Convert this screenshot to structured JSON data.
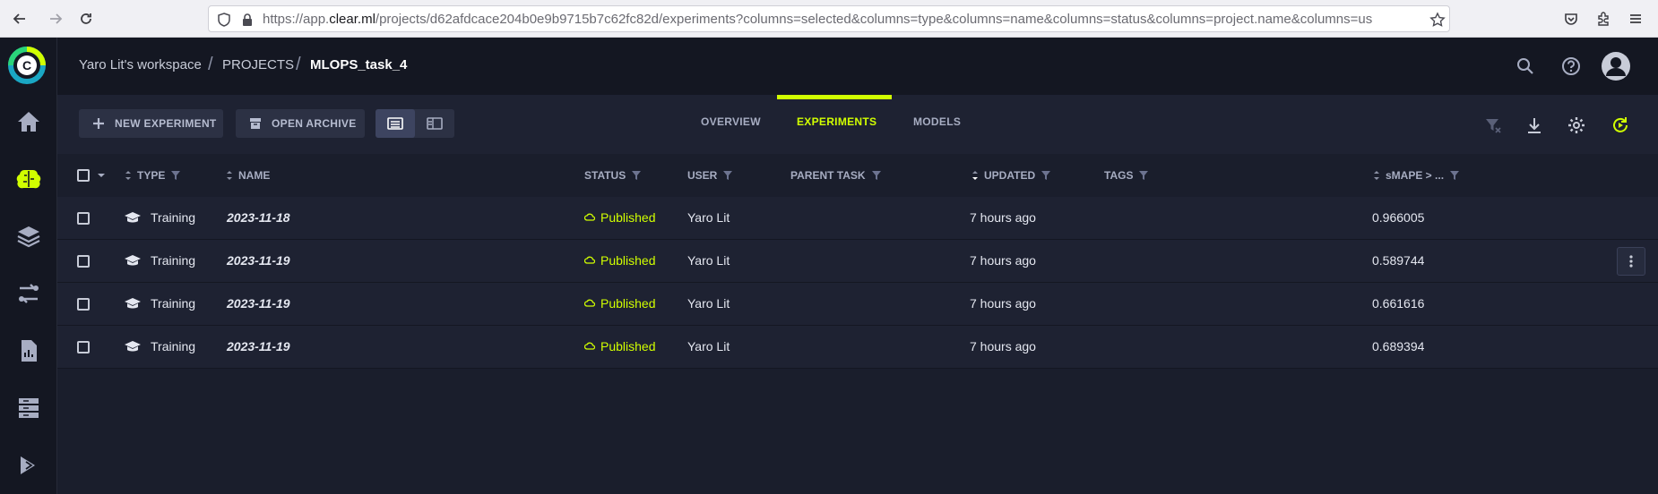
{
  "browser": {
    "url_prefix": "https://app.",
    "url_host": "clear.ml",
    "url_rest": "/projects/d62afdcace204b0e9b9715b7c62fc82d/experiments?columns=selected&columns=type&columns=name&columns=status&columns=project.name&columns=us"
  },
  "breadcrumb": {
    "workspace": "Yaro Lit's workspace",
    "projects": "PROJECTS",
    "current": "MLOPS_task_4"
  },
  "toolbar": {
    "new_experiment": "NEW EXPERIMENT",
    "open_archive": "OPEN ARCHIVE"
  },
  "tabs": [
    {
      "label": "OVERVIEW"
    },
    {
      "label": "EXPERIMENTS"
    },
    {
      "label": "MODELS"
    }
  ],
  "columns": {
    "type": "TYPE",
    "name": "NAME",
    "status": "STATUS",
    "user": "USER",
    "parent_task": "PARENT TASK",
    "updated": "UPDATED",
    "tags": "TAGS",
    "smape": "sMAPE > ..."
  },
  "rows": [
    {
      "type": "Training",
      "name": "2023-11-18",
      "status": "Published",
      "user": "Yaro Lit",
      "updated": "7 hours ago",
      "smape": "0.966005"
    },
    {
      "type": "Training",
      "name": "2023-11-19",
      "status": "Published",
      "user": "Yaro Lit",
      "updated": "7 hours ago",
      "smape": "0.589744"
    },
    {
      "type": "Training",
      "name": "2023-11-19",
      "status": "Published",
      "user": "Yaro Lit",
      "updated": "7 hours ago",
      "smape": "0.661616"
    },
    {
      "type": "Training",
      "name": "2023-11-19",
      "status": "Published",
      "user": "Yaro Lit",
      "updated": "7 hours ago",
      "smape": "0.689394"
    }
  ],
  "colors": {
    "accent": "#d1ff00",
    "background": "#1a1e2c",
    "row_bg": "#1e2232",
    "sidebar_bg": "#141722"
  }
}
